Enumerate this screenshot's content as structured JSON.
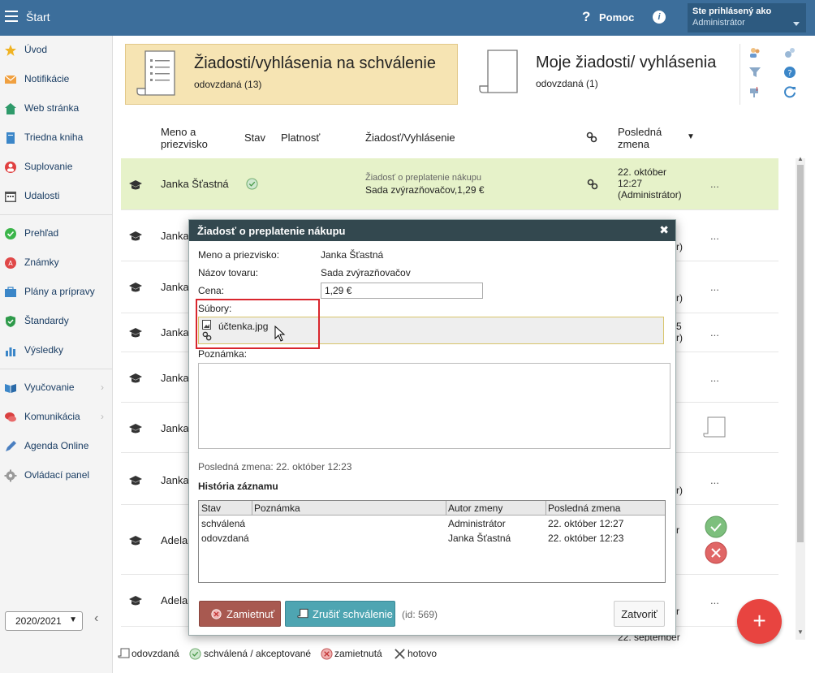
{
  "topbar": {
    "app_title": "Štart",
    "help_label": "Pomoc",
    "user_line1": "Ste prihlásený ako",
    "user_line2": "Administrátor"
  },
  "sidebar": {
    "items": [
      {
        "label": "Úvod",
        "icon": "star-icon"
      },
      {
        "label": "Notifikácie",
        "icon": "envelope-icon"
      },
      {
        "label": "Web stránka",
        "icon": "house-icon"
      },
      {
        "label": "Triedna kniha",
        "icon": "book-icon"
      },
      {
        "label": "Suplovanie",
        "icon": "person-icon"
      },
      {
        "label": "Udalosti",
        "icon": "calendar-icon"
      },
      {
        "label": "Prehľad",
        "icon": "check-circle-icon"
      },
      {
        "label": "Známky",
        "icon": "grade-icon"
      },
      {
        "label": "Plány a prípravy",
        "icon": "briefcase-icon"
      },
      {
        "label": "Štandardy",
        "icon": "shield-icon"
      },
      {
        "label": "Výsledky",
        "icon": "bar-chart-icon"
      },
      {
        "label": "Vyučovanie",
        "icon": "open-book-icon"
      },
      {
        "label": "Komunikácia",
        "icon": "chat-icon"
      },
      {
        "label": "Agenda Online",
        "icon": "pen-icon"
      },
      {
        "label": "Ovládací panel",
        "icon": "gear-icon"
      }
    ],
    "year": "2020/2021"
  },
  "cards": {
    "card1_title": "Žiadosti/vyhlásenia na schválenie",
    "card1_sub": "odovzdaná (13)",
    "card2_title": "Moje žiadosti/ vyhlásenia",
    "card2_sub": "odovzdaná (1)"
  },
  "table": {
    "headers": {
      "name": "Meno a priezvisko",
      "status": "Stav",
      "validity": "Platnosť",
      "request": "Žiadosť/Vyhlásenie",
      "last_change": "Posledná zmena"
    },
    "first_row": {
      "name": "Janka Šťastná",
      "request_title": "Žiadosť o preplatenie nákupu",
      "request_detail": "Sada zvýrazňovačov,1,29 €",
      "change_date": "22. október",
      "change_time": "12:27",
      "change_by": "(Administrátor)",
      "more": "..."
    },
    "rows": [
      {
        "name": "Janka",
        "tail": "r)"
      },
      {
        "name": "Janka",
        "tail": "r)"
      },
      {
        "name": "Janka",
        "tail": "5 r)"
      },
      {
        "name": "Janka",
        "tail": ""
      },
      {
        "name": "Janka",
        "tail": ""
      },
      {
        "name": "Janka",
        "tail": "r)"
      },
      {
        "name": "Adela",
        "tail": "r"
      },
      {
        "name": "Adela",
        "tail": "r"
      }
    ],
    "bottom_partial": "22. september",
    "more": "..."
  },
  "legend": {
    "submitted": "odovzdaná",
    "approved": "schválená / akceptované",
    "rejected": "zamietnutá",
    "done": "hotovo"
  },
  "modal": {
    "title": "Žiadosť o preplatenie nákupu",
    "name_label": "Meno a priezvisko:",
    "name_value": "Janka Šťastná",
    "product_label": "Názov tovaru:",
    "product_value": "Sada zvýrazňovačov",
    "price_label": "Cena:",
    "price_value": "1,29 €",
    "files_label": "Súbory:",
    "file_name": "účtenka.jpg",
    "note_label": "Poznámka:",
    "last_change": "Posledná zmena: 22. október 12:23",
    "history_title": "História záznamu",
    "history_headers": [
      "Stav",
      "Poznámka",
      "Autor zmeny",
      "Posledná zmena"
    ],
    "history_rows": [
      [
        "schválená",
        "",
        "Administrátor",
        "22. október 12:27"
      ],
      [
        "odovzdaná",
        "",
        "Janka Šťastná",
        "22. október 12:23"
      ]
    ],
    "reject_label": "Zamietnuť",
    "cancel_approval_label": "Zrušiť schválenie",
    "id_text": "(id: 569)",
    "close_label": "Zatvoriť"
  },
  "fab_label": "+"
}
